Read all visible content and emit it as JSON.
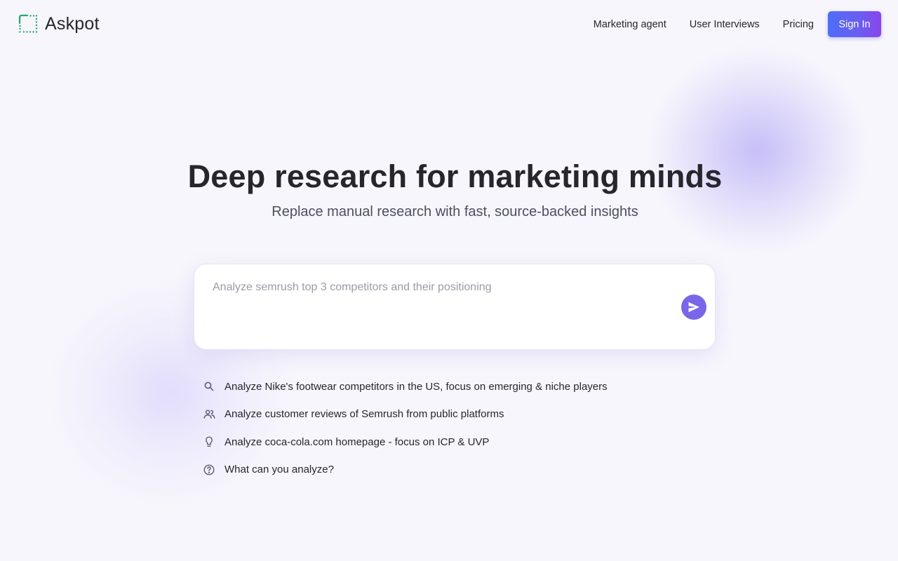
{
  "brand": {
    "name": "Askpot",
    "accent_color": "#1eaa6a"
  },
  "nav": {
    "links": [
      {
        "label": "Marketing agent"
      },
      {
        "label": "User Interviews"
      },
      {
        "label": "Pricing"
      }
    ],
    "signin_label": "Sign In"
  },
  "hero": {
    "title": "Deep research for marketing minds",
    "subtitle": "Replace manual research with fast, source-backed insights"
  },
  "prompt": {
    "placeholder": "Analyze semrush top 3 competitors and their positioning",
    "value": "",
    "send_icon": "send-icon",
    "send_color": "#7a66e8"
  },
  "suggestions": [
    {
      "icon": "search-icon",
      "label": "Analyze Nike's footwear competitors in the US, focus on emerging & niche players"
    },
    {
      "icon": "users-icon",
      "label": "Analyze customer reviews of Semrush from public platforms"
    },
    {
      "icon": "lightbulb-icon",
      "label": "Analyze coca-cola.com homepage - focus on ICP & UVP"
    },
    {
      "icon": "help-circle-icon",
      "label": "What can you analyze?"
    }
  ]
}
